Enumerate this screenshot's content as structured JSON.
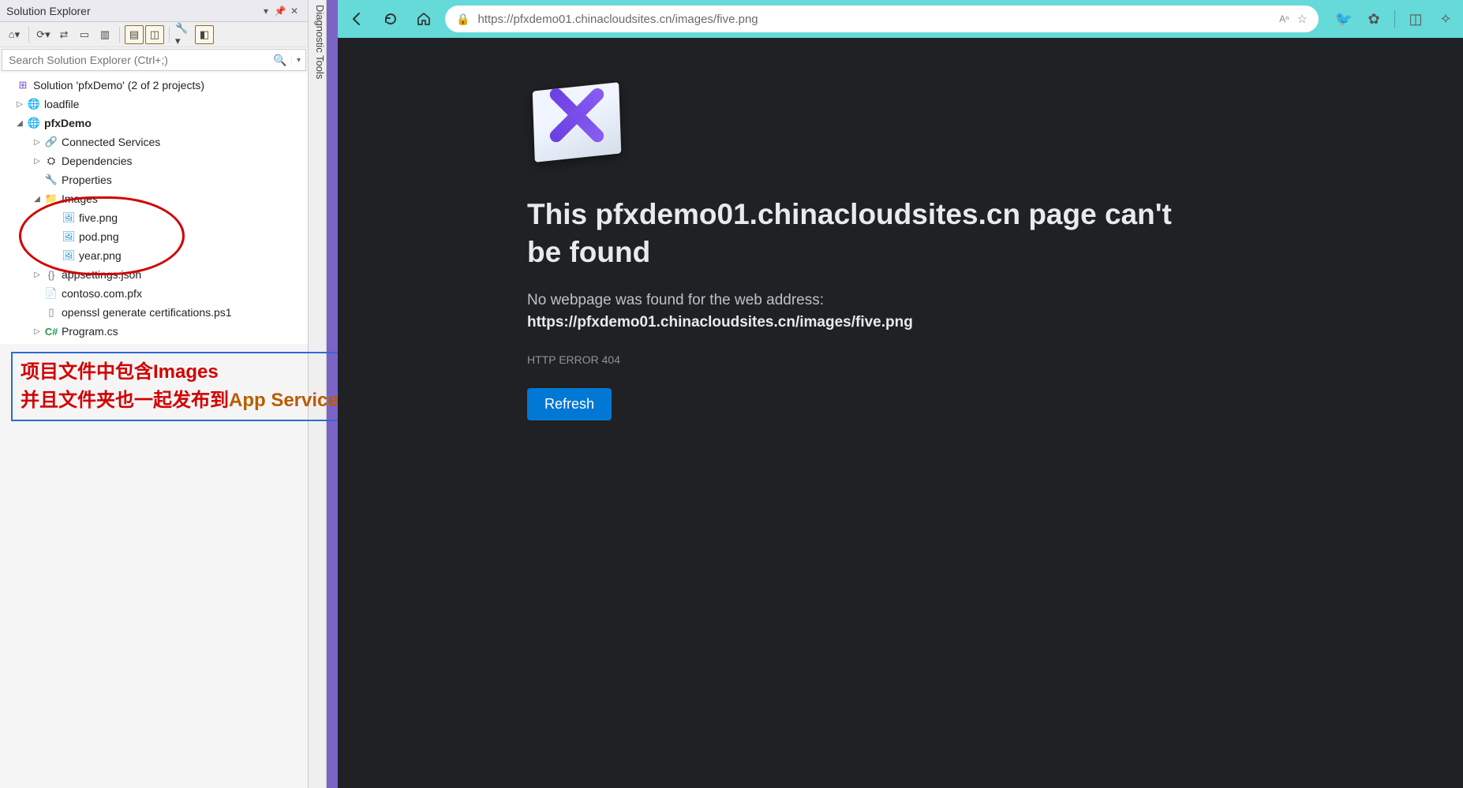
{
  "solution_explorer": {
    "title": "Solution Explorer",
    "search_placeholder": "Search Solution Explorer (Ctrl+;)",
    "solution_label": "Solution 'pfxDemo' (2 of 2 projects)",
    "tree": {
      "loadfile": "loadfile",
      "pfxDemo": "pfxDemo",
      "connected_services": "Connected Services",
      "dependencies": "Dependencies",
      "properties": "Properties",
      "images": "Images",
      "five_png": "five.png",
      "pod_png": "pod.png",
      "year_png": "year.png",
      "appsettings": "appsettings.json",
      "contoso_pfx": "contoso.com.pfx",
      "openssl_ps1": "openssl generate certifications.ps1",
      "program_cs": "Program.cs"
    }
  },
  "diagnostic_tab": "Diagnostic Tools",
  "annotation": {
    "line1": "项目文件中包含Images",
    "line2a": "并且文件夹也一起发布到",
    "line2b": "App Service中"
  },
  "browser": {
    "url": "https://pfxdemo01.chinacloudsites.cn/images/five.png",
    "aa_label": "Aⁿ"
  },
  "error_page": {
    "title": "This pfxdemo01.chinacloudsites.cn page can't be found",
    "subtitle": "No webpage was found for the web address:",
    "url": "https://pfxdemo01.chinacloudsites.cn/images/five.png",
    "code": "HTTP ERROR 404",
    "refresh": "Refresh"
  }
}
